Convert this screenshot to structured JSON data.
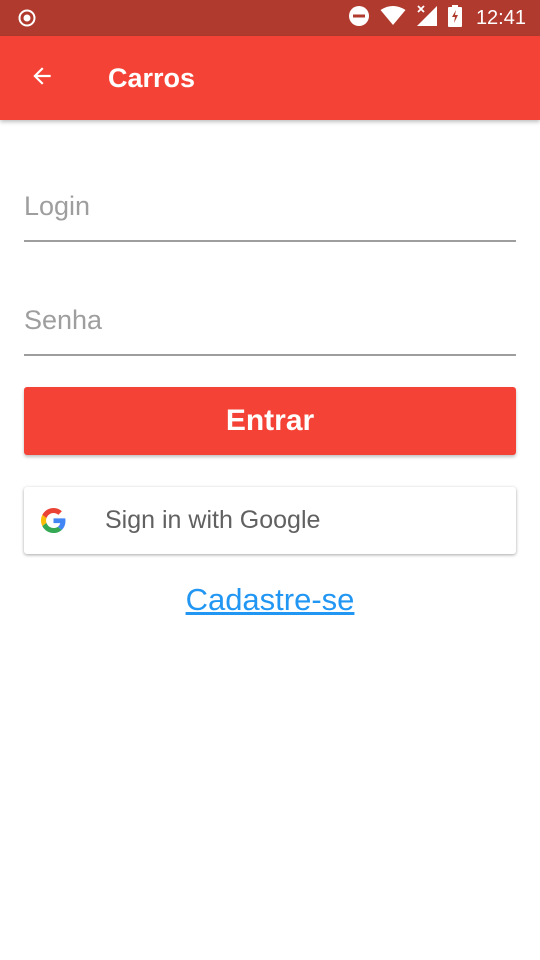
{
  "status_bar": {
    "time": "12:41",
    "icons": [
      "radio-icon",
      "do-not-disturb-icon",
      "wifi-icon",
      "signal-icon",
      "battery-charging-icon"
    ]
  },
  "app_bar": {
    "title": "Carros",
    "back_icon": "arrow-back-icon",
    "background_color": "#f44336"
  },
  "form": {
    "login_placeholder": "Login",
    "login_value": "",
    "senha_placeholder": "Senha",
    "senha_value": "",
    "entrar_label": "Entrar",
    "google_label": "Sign in with Google",
    "google_icon": "google-logo-icon",
    "cadastre_label": "Cadastre-se"
  },
  "colors": {
    "accent": "#f44336",
    "status_bar": "#b03a2e",
    "link": "#2196f3"
  }
}
